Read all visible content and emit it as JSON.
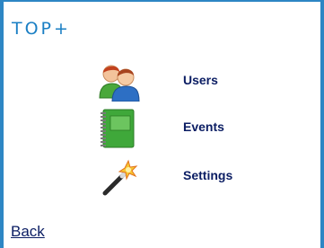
{
  "header": {
    "logo_text": "TOP+"
  },
  "menu": {
    "items": [
      {
        "label": "Users",
        "icon": "users-icon"
      },
      {
        "label": "Events",
        "icon": "notebook-icon"
      },
      {
        "label": "Settings",
        "icon": "magic-wand-icon"
      }
    ]
  },
  "footer": {
    "back_label": "Back"
  },
  "colors": {
    "frame_border": "#2d86c4",
    "logo": "#1a7fc4",
    "text": "#0b1d63"
  }
}
